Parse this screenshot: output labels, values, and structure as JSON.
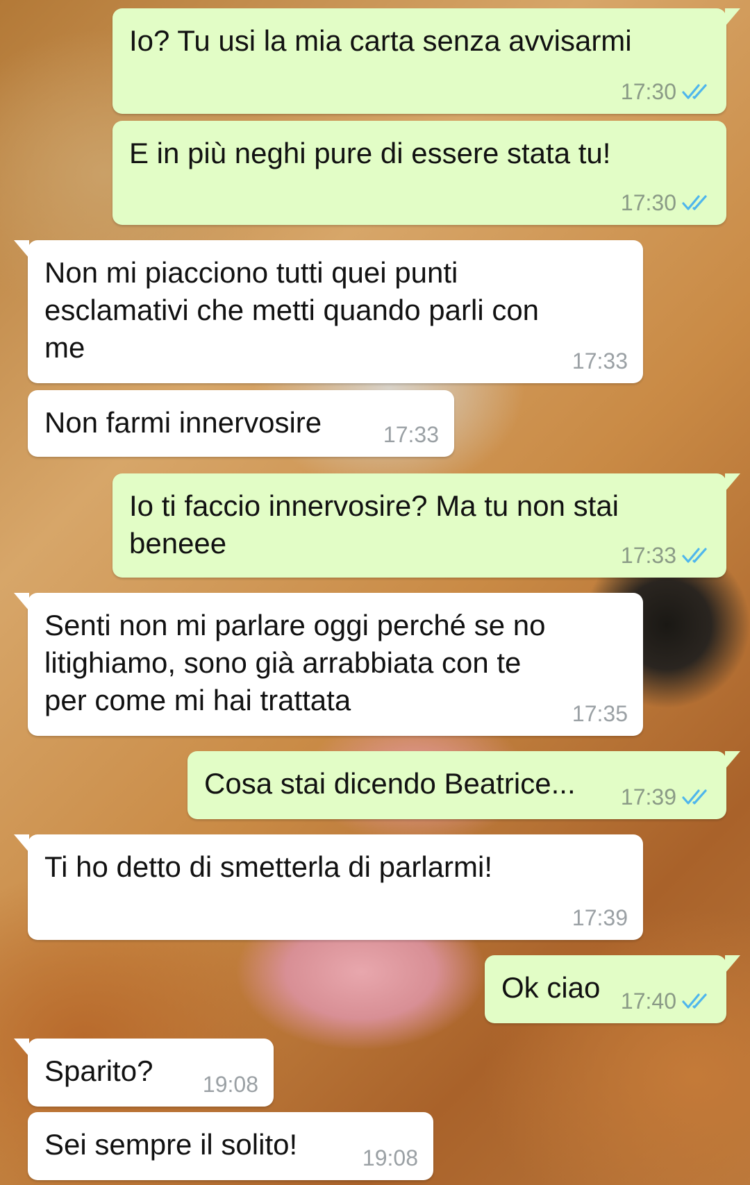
{
  "colors": {
    "outgoing_bubble": "#e2fdc6",
    "incoming_bubble": "#ffffff",
    "read_receipt": "#4fb6ec",
    "timestamp": "#9aa0a4"
  },
  "messages": [
    {
      "direction": "outgoing",
      "text": "Io? Tu usi la mia carta senza avvisarmi",
      "time": "17:30",
      "status_icon": "double-check-read-icon"
    },
    {
      "direction": "outgoing",
      "text": "E in più neghi pure di essere stata tu!",
      "time": "17:30",
      "status_icon": "double-check-read-icon"
    },
    {
      "direction": "incoming",
      "text": "Non mi piacciono tutti quei punti esclamativi che metti quando parli con me",
      "time": "17:33"
    },
    {
      "direction": "incoming",
      "text": "Non farmi innervosire",
      "time": "17:33"
    },
    {
      "direction": "outgoing",
      "text": "Io ti faccio innervosire? Ma tu non stai beneee",
      "time": "17:33",
      "status_icon": "double-check-read-icon"
    },
    {
      "direction": "incoming",
      "text": "Senti non mi parlare oggi perché se no litighiamo, sono già arrabbiata con te per come mi hai trattata",
      "time": "17:35"
    },
    {
      "direction": "outgoing",
      "text": "Cosa stai dicendo Beatrice...",
      "time": "17:39",
      "status_icon": "double-check-read-icon"
    },
    {
      "direction": "incoming",
      "text": "Ti ho detto di smetterla di parlarmi!",
      "time": "17:39"
    },
    {
      "direction": "outgoing",
      "text": "Ok ciao",
      "time": "17:40",
      "status_icon": "double-check-read-icon"
    },
    {
      "direction": "incoming",
      "text": "Sparito?",
      "time": "19:08"
    },
    {
      "direction": "incoming",
      "text": "Sei sempre il solito!",
      "time": "19:08"
    }
  ]
}
